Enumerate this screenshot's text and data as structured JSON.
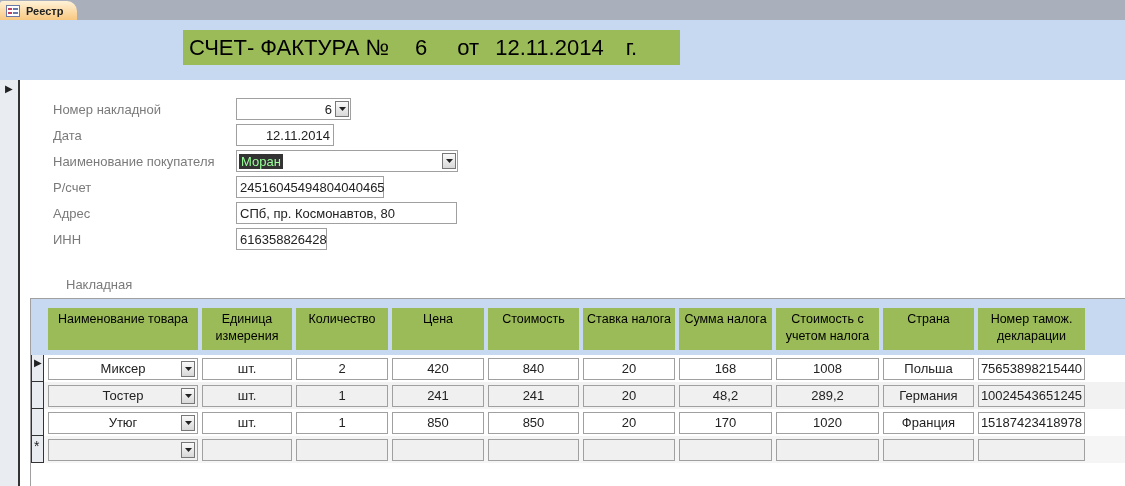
{
  "tab": {
    "label": "Реестр",
    "selected": true
  },
  "record_selector": "▶",
  "title": {
    "caption": "СЧЕТ- ФАКТУРА №",
    "number": "6",
    "from": "от",
    "date": "12.11.2014",
    "year_suffix": "г."
  },
  "fields": [
    {
      "label": "Номер накладной",
      "value": "6",
      "kind": "combo"
    },
    {
      "label": "Дата",
      "value": "12.11.2014",
      "kind": "text"
    },
    {
      "label": "Наименование покупателя",
      "value": "Моран",
      "kind": "combo",
      "highlighted": true
    },
    {
      "label": "Р/счет",
      "value": "24516045494804040465",
      "kind": "text"
    },
    {
      "label": "Адрес",
      "value": "СПб, пр. Космонавтов, 80",
      "kind": "text"
    },
    {
      "label": "ИНН",
      "value": "616358826428",
      "kind": "text"
    }
  ],
  "subform": {
    "label": "Накладная",
    "columns": [
      "Наименование товара",
      "Единица измерения",
      "Количество",
      "Цена",
      "Стоимость",
      "Ставка налога",
      "Сумма налога",
      "Стоимость с учетом налога",
      "Страна",
      "Номер тамож. декларации"
    ],
    "rows": [
      {
        "selector": "▶",
        "cells": [
          "Миксер",
          "шт.",
          "2",
          "420",
          "840",
          "20",
          "168",
          "1008",
          "Польша",
          "75653898215440"
        ]
      },
      {
        "cells": [
          "Тостер",
          "шт.",
          "1",
          "241",
          "241",
          "20",
          "48,2",
          "289,2",
          "Германия",
          "10024543651245"
        ]
      },
      {
        "cells": [
          "Утюг",
          "шт.",
          "1",
          "850",
          "850",
          "20",
          "170",
          "1020",
          "Франция",
          "15187423418978"
        ]
      },
      {
        "selector": "*",
        "new": true
      }
    ]
  }
}
